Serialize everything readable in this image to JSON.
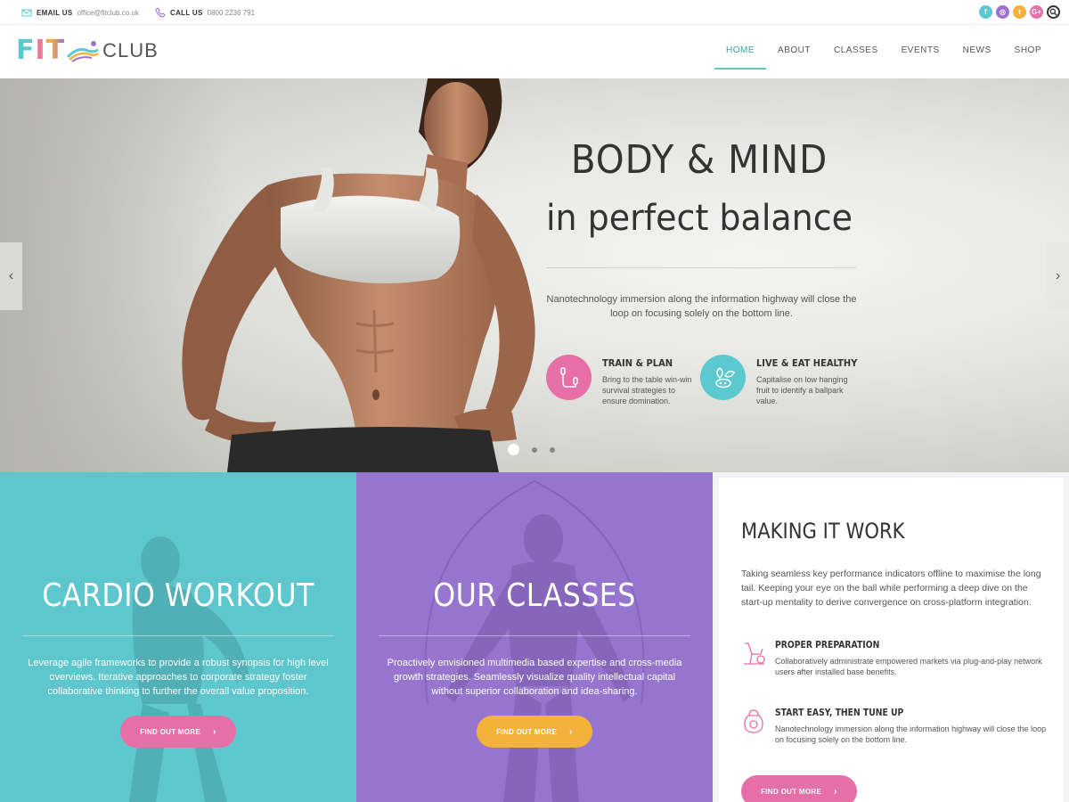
{
  "topbar": {
    "email_label": "EMAIL US",
    "email_value": "office@fitclub.co.uk",
    "call_label": "CALL US",
    "call_value": "0800 2236 791",
    "socials": [
      {
        "icon": "facebook-icon",
        "glyph": "f",
        "color": "#5cc8d0"
      },
      {
        "icon": "instagram-icon",
        "glyph": "◎",
        "color": "#9b72cf"
      },
      {
        "icon": "twitter-icon",
        "glyph": "t",
        "color": "#f5b23a"
      },
      {
        "icon": "google-plus-icon",
        "glyph": "G+",
        "color": "#e76fa8"
      }
    ]
  },
  "brand": {
    "logo_main": "FIT",
    "logo_sub": "CLUB"
  },
  "nav": [
    {
      "label": "HOME",
      "active": true
    },
    {
      "label": "ABOUT",
      "active": false
    },
    {
      "label": "CLASSES",
      "active": false
    },
    {
      "label": "EVENTS",
      "active": false
    },
    {
      "label": "NEWS",
      "active": false
    },
    {
      "label": "SHOP",
      "active": false
    }
  ],
  "hero": {
    "title_line1": "BODY & MIND",
    "title_line2": "in perfect balance",
    "subtitle": "Nanotechnology immersion along the information highway will close the loop on focusing solely on the bottom line.",
    "features": [
      {
        "icon": "jump-rope-icon",
        "color": "#e76fa8",
        "title": "TRAIN & PLAN",
        "text": "Bring to the table win-win survival strategies to ensure domination."
      },
      {
        "icon": "healthy-food-icon",
        "color": "#5cc8d0",
        "title": "LIVE & EAT HEALTHY",
        "text": "Capitalise on low hanging fruit to identify a ballpark value."
      }
    ],
    "prev_icon": "chevron-left-icon",
    "next_icon": "chevron-right-icon",
    "slides": 3,
    "active_slide": 1
  },
  "panels": [
    {
      "title": "CARDIO WORKOUT",
      "text": "Leverage agile frameworks to provide a robust synopsis for high level overviews. Iterative approaches to corporate strategy foster collaborative thinking to further the overall value proposition.",
      "button": "FIND OUT MORE",
      "bg": "#5ec6cd",
      "button_color": "#e76fa8"
    },
    {
      "title": "OUR CLASSES",
      "text": "Proactively envisioned multimedia based expertise and cross-media growth strategies. Seamlessly visualize quality intellectual capital without superior collaboration and idea-sharing.",
      "button": "FIND OUT MORE",
      "bg": "#9675cf",
      "button_color": "#f5b23a"
    }
  ],
  "making_it_work": {
    "title": "MAKING IT WORK",
    "text": "Taking seamless key performance indicators offline to maximise the long tail. Keeping your eye on the ball while performing a deep dive on the start-up mentality to derive convergence on cross-platform integration.",
    "items": [
      {
        "icon": "exercise-bike-icon",
        "title": "PROPER PREPARATION",
        "text": "Collaboratively administrate empowered markets via plug-and-play network users after installed base benefits."
      },
      {
        "icon": "kettlebell-icon",
        "title": "START EASY, THEN TUNE UP",
        "text": "Nanotechnology immersion along the information highway will close the loop on focusing solely on the bottom line."
      }
    ],
    "button": "FIND OUT MORE",
    "button_color": "#e76fa8"
  },
  "colors": {
    "teal": "#5cc8d0",
    "purple": "#9b72cf",
    "pink": "#e76fa8",
    "orange": "#f5b23a"
  }
}
